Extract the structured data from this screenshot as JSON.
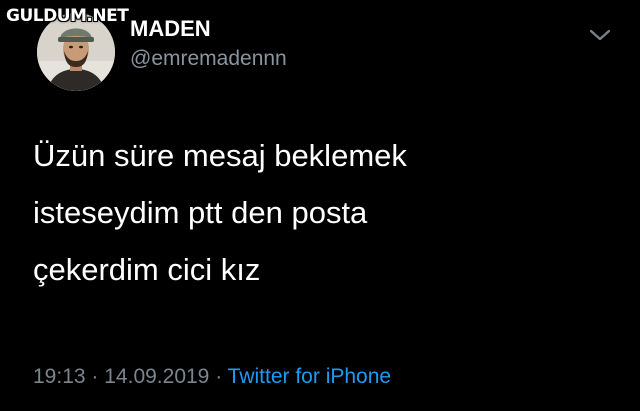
{
  "watermark": "GULDUM.NET",
  "tweet": {
    "display_name": "MADEN",
    "handle": "@emremadennn",
    "text_lines": [
      "Üzün süre mesaj beklemek",
      "isteseydim ptt den posta",
      "çekerdim cici kız"
    ],
    "time": "19:13",
    "separator": "·",
    "date": "14.09.2019",
    "source": "Twitter for iPhone"
  },
  "icons": {
    "avatar": "profile-photo",
    "menu": "chevron-down-icon"
  },
  "colors": {
    "background": "#000000",
    "text": "#ffffff",
    "secondary": "#8a949e",
    "link": "#1d9bf0"
  }
}
